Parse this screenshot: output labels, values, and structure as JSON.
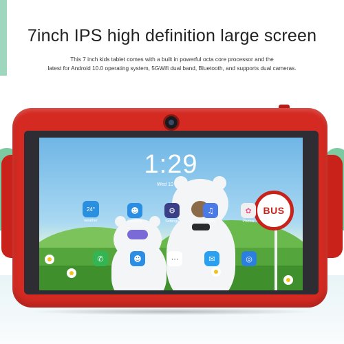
{
  "headline": "7inch IPS high definition large screen",
  "description_lines": [
    "This 7 inch kids tablet comes with a built in powerful octa core processor and the",
    "latest for Android 10.0 operating system, 5GWifi dual band, Bluetooth, and supports dual cameras."
  ],
  "screen": {
    "time": "1:29",
    "date": "Wed 10 June",
    "bus_sign": "BUS",
    "weather": {
      "temp": "24°",
      "label": "weather"
    },
    "apps_row1": [
      {
        "label": "Contacts",
        "icon": "contacts-icon",
        "color": "#2a8ee4"
      },
      {
        "label": "Settings",
        "icon": "settings-icon",
        "color": "#3a3f88"
      },
      {
        "label": "Music",
        "icon": "music-icon",
        "color": "#4a7ae8"
      },
      {
        "label": "Photos",
        "icon": "photos-icon",
        "color": "#f0f0f0"
      }
    ],
    "dock": [
      {
        "icon": "phone-icon",
        "color": "#32b552"
      },
      {
        "icon": "contacts-icon",
        "color": "#2a8ee4"
      },
      {
        "icon": "apps-grid-icon",
        "color": "#ffffff"
      },
      {
        "icon": "messages-icon",
        "color": "#2aa0f0"
      },
      {
        "icon": "browser-icon",
        "color": "#2a7fe0"
      }
    ]
  }
}
